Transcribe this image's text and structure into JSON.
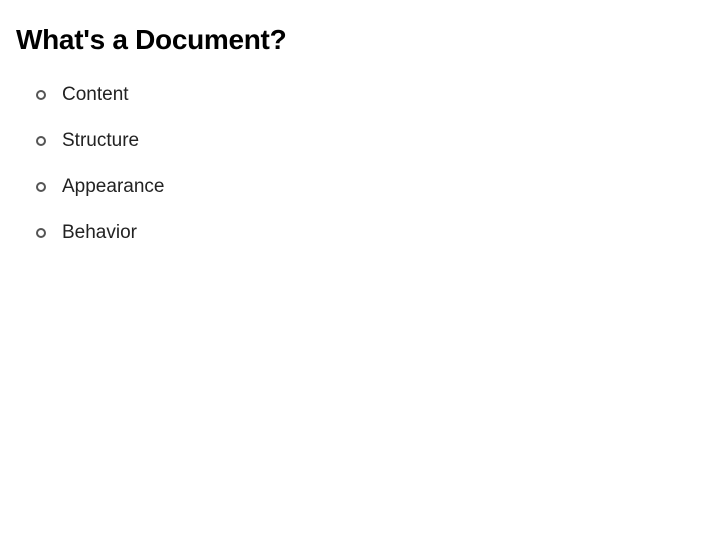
{
  "title": "What's a Document?",
  "items": [
    {
      "label": "Content"
    },
    {
      "label": "Structure"
    },
    {
      "label": "Appearance"
    },
    {
      "label": "Behavior"
    }
  ]
}
